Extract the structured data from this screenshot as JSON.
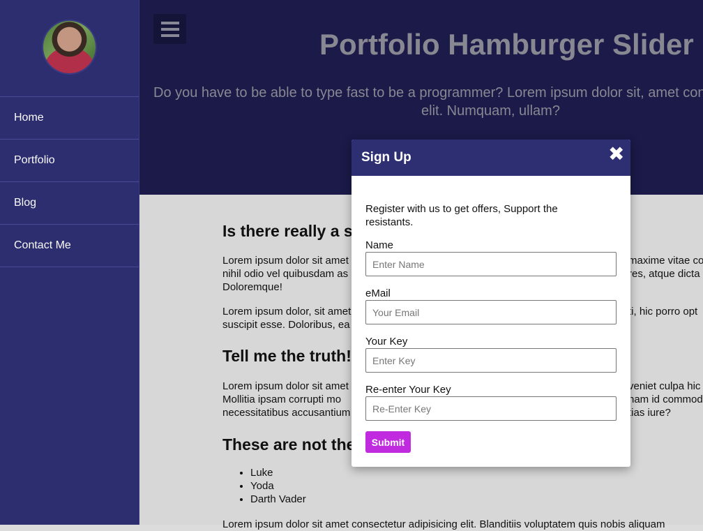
{
  "sidebar": {
    "items": [
      {
        "label": "Home"
      },
      {
        "label": "Portfolio"
      },
      {
        "label": "Blog"
      },
      {
        "label": "Contact Me"
      }
    ]
  },
  "hero": {
    "title": "Portfolio Hamburger Slider",
    "subtitle_line1": "Do you have to be able to type fast to be a programmer? Lorem ipsum dolor sit, amet cons",
    "subtitle_line2": "elit. Numquam, ullam?"
  },
  "content": {
    "heading1": "Is there really a sh",
    "para1_line1": "Lorem ipsum dolor sit amet",
    "para1_line2": "nihil odio vel quibusdam as",
    "para1_line3": "Doloremque!",
    "para1_right1": "maxime vitae co",
    "para1_right2": "res, atque dicta",
    "para2_line1": "Lorem ipsum dolor, sit amet",
    "para2_line2": "suscipit esse. Doloribus, ea",
    "para2_right1": "ti, hic porro opt",
    "heading2": "Tell me the truth!",
    "para3_line1": "Lorem ipsum dolor sit amet",
    "para3_line2": "Mollitia ipsam corrupti mo",
    "para3_line3": "necessitatibus accusantium",
    "para3_right1": "veniet culpa hic",
    "para3_right2": "nam id commodi",
    "para3_right3": "tias iure?",
    "heading3": "These are not the",
    "list": [
      "Luke",
      "Yoda",
      "Darth Vader"
    ],
    "para4_line1": "Lorem ipsum dolor sit amet consectetur adipisicing elit. Blanditiis voluptatem quis nobis aliquam"
  },
  "modal": {
    "title": "Sign Up",
    "close_symbol": "✖",
    "intro": "Register with us to get offers, Support the resistants.",
    "fields": [
      {
        "label": "Name",
        "placeholder": "Enter Name"
      },
      {
        "label": "eMail",
        "placeholder": "Your Email"
      },
      {
        "label": "Your Key",
        "placeholder": "Enter Key"
      },
      {
        "label": "Re-enter Your Key",
        "placeholder": "Re-Enter Key"
      }
    ],
    "submit_label": "Submit"
  },
  "colors": {
    "sidebar": "#2e2f72",
    "hero": "#1c1b4a",
    "accent": "#c02be0"
  }
}
